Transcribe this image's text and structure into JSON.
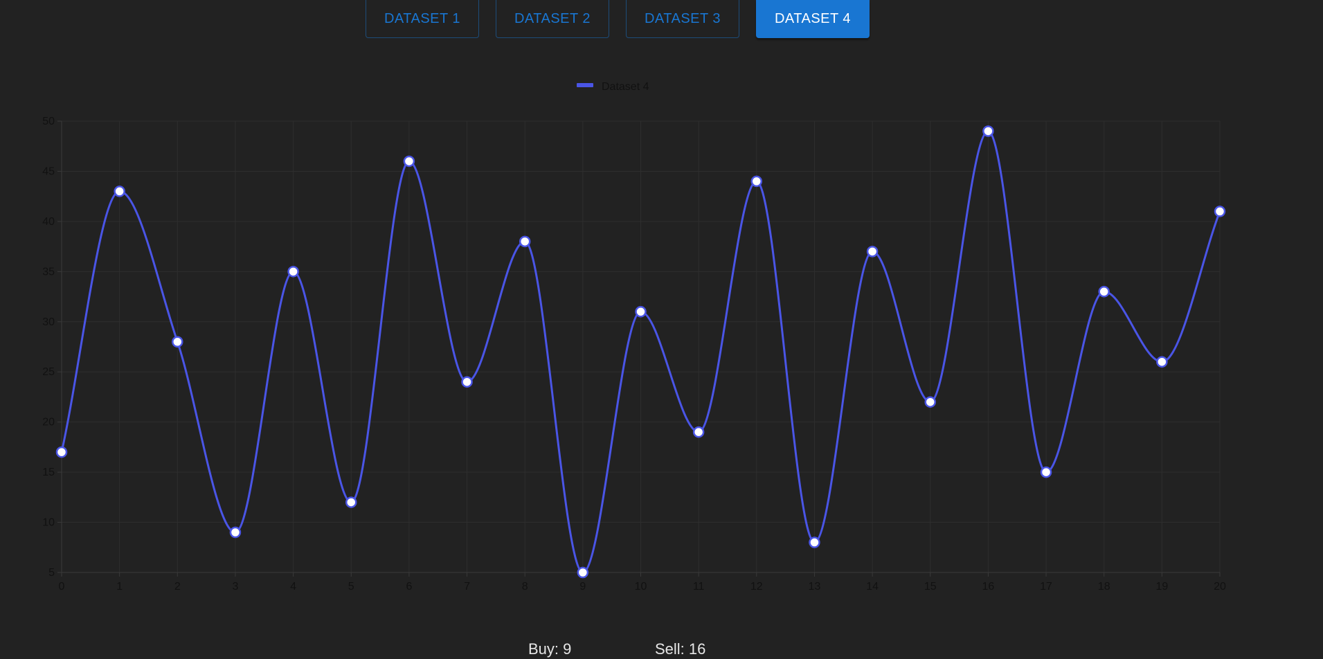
{
  "tabs": [
    {
      "label": "DATASET 1",
      "active": false
    },
    {
      "label": "DATASET 2",
      "active": false
    },
    {
      "label": "DATASET 3",
      "active": false
    },
    {
      "label": "DATASET 4",
      "active": true
    }
  ],
  "footer": {
    "buy": "Buy: 9",
    "sell": "Sell: 16"
  },
  "colors": {
    "line": "#4a55e6",
    "accent": "#1976d2",
    "background": "#222222",
    "grid": "#2e2e2e",
    "axis_text": "#111111"
  },
  "chart_data": {
    "type": "line",
    "smooth": true,
    "legend": {
      "position": "top-center"
    },
    "x": [
      0,
      1,
      2,
      3,
      4,
      5,
      6,
      7,
      8,
      9,
      10,
      11,
      12,
      13,
      14,
      15,
      16,
      17,
      18,
      19,
      20
    ],
    "series": [
      {
        "name": "Dataset 4",
        "values": [
          17,
          43,
          28,
          9,
          35,
          12,
          46,
          24,
          38,
          5,
          31,
          19,
          44,
          8,
          37,
          22,
          49,
          15,
          33,
          26,
          41
        ]
      }
    ],
    "xticks": [
      "0",
      "1",
      "2",
      "3",
      "4",
      "5",
      "6",
      "7",
      "8",
      "9",
      "10",
      "11",
      "12",
      "13",
      "14",
      "15",
      "16",
      "17",
      "18",
      "19",
      "20"
    ],
    "yticks": [
      "5",
      "10",
      "15",
      "20",
      "25",
      "30",
      "35",
      "40",
      "45",
      "50"
    ],
    "xlim": [
      0,
      20
    ],
    "ylim": [
      5,
      50
    ],
    "grid": true,
    "title": "",
    "xlabel": "",
    "ylabel": ""
  }
}
